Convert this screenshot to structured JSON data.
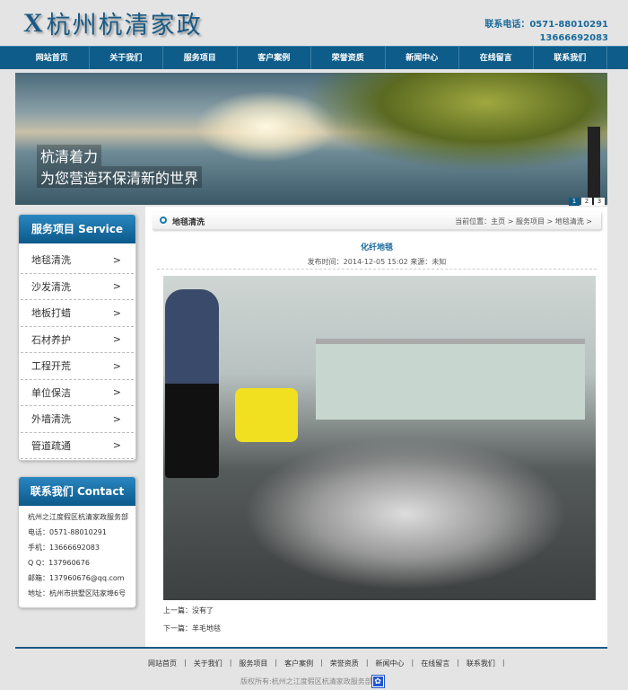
{
  "header": {
    "logo_mark": "X",
    "logo_text": "杭州杭清家政",
    "phone_label": "联系电话：0571-88010291",
    "phone2": "13666692083"
  },
  "nav": [
    "网站首页",
    "关于我们",
    "服务项目",
    "客户案例",
    "荣誉资质",
    "新闻中心",
    "在线留言",
    "联系我们"
  ],
  "banner": {
    "line1": "杭清着力",
    "line2": "为您营造环保清新的世界",
    "pages": [
      "1",
      "2",
      "3"
    ],
    "active_page": "1"
  },
  "services": {
    "title": "服务项目 Service",
    "items": [
      "地毯清洗",
      "沙发清洗",
      "地板打蜡",
      "石材养护",
      "工程开荒",
      "单位保洁",
      "外墙清洗",
      "管道疏通"
    ],
    "arrow": ">"
  },
  "contact": {
    "title": "联系我们 Contact",
    "lines": [
      "杭州之江度假区杭清家政服务部",
      "电话：0571-88010291",
      "手机：13666692083",
      "Q Q：137960676",
      "邮箱：137960676@qq.com",
      "地址：杭州市拱墅区陆家埠6号"
    ]
  },
  "content": {
    "section": "地毯清洗",
    "breadcrumb": "当前位置：主页 > 服务项目 > 地毯清洗 >",
    "title": "化纤地毯",
    "meta": "发布时间：2014-12-05 15:02 来源：未知",
    "prev": "上一篇：没有了",
    "next": "下一篇：羊毛地毯"
  },
  "footer": {
    "links": [
      "网站首页",
      "关于我们",
      "服务项目",
      "客户案例",
      "荣誉资质",
      "新闻中心",
      "在线留言",
      "联系我们"
    ],
    "copyright": "版权所有:杭州之江度假区杭清家政服务部",
    "paw_icon": "baidu-paw-icon"
  },
  "colors": {
    "primary": "#0d5c89",
    "accent": "#1a6a9a"
  }
}
